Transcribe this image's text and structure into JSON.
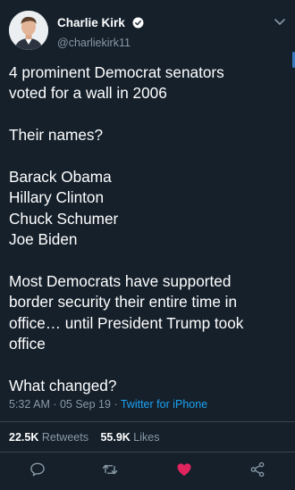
{
  "author": {
    "display_name": "Charlie Kirk",
    "handle": "@charliekirk11",
    "verified": true
  },
  "tweet": {
    "paragraphs": [
      [
        "4 prominent Democrat senators",
        "voted for a wall in 2006"
      ],
      [
        "Their names?"
      ],
      [
        "Barack Obama",
        "Hillary Clinton",
        "Chuck Schumer",
        "Joe Biden"
      ],
      [
        "Most Democrats have supported",
        "border security their entire time in",
        "office… until President Trump took",
        "office"
      ],
      [
        "What changed?"
      ]
    ],
    "timestamp": "5:32 AM · 05 Sep 19 · ",
    "source": "Twitter for iPhone"
  },
  "stats": {
    "retweets_count": "22.5K",
    "retweets_label": "Retweets",
    "likes_count": "55.9K",
    "likes_label": "Likes"
  },
  "actions": [
    {
      "name": "reply-icon"
    },
    {
      "name": "retweet-icon"
    },
    {
      "name": "like-icon",
      "liked": true
    },
    {
      "name": "share-icon"
    }
  ],
  "colors": {
    "background": "#15202b",
    "secondary_text": "#8899a6",
    "link": "#1da1f2",
    "like": "#e0245e",
    "divider": "#38444d"
  }
}
